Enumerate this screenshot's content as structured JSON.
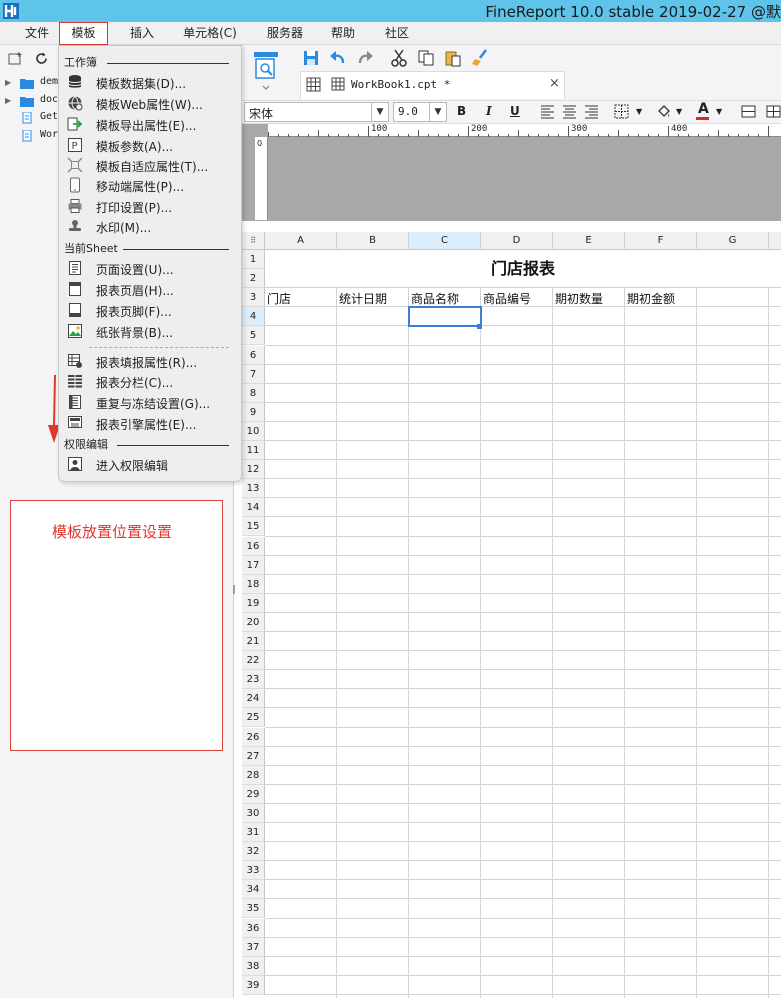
{
  "window": {
    "title": "FineReport 10.0 stable 2019-02-27 @默"
  },
  "menubar": {
    "items": [
      {
        "label": "文件"
      },
      {
        "label": "模板"
      },
      {
        "label": "插入"
      },
      {
        "label": "单元格(C)"
      },
      {
        "label": "服务器"
      },
      {
        "label": "帮助"
      },
      {
        "label": "社区"
      }
    ]
  },
  "tree": {
    "items": [
      {
        "label": "dem",
        "icon": "folder-icon"
      },
      {
        "label": "doc",
        "icon": "folder-icon"
      },
      {
        "label": "Get",
        "icon": "report-file-icon"
      },
      {
        "label": "Wor",
        "icon": "report-file-icon"
      }
    ]
  },
  "dropdown": {
    "sections": [
      {
        "title": "工作簿",
        "items": [
          {
            "label": "模板数据集(D)...",
            "icon": "database-icon"
          },
          {
            "label": "模板Web属性(W)...",
            "icon": "web-globe-icon"
          },
          {
            "label": "模板导出属性(E)...",
            "icon": "export-icon"
          },
          {
            "label": "模板参数(A)...",
            "icon": "parameter-icon"
          },
          {
            "label": "模板自适应属性(T)...",
            "icon": "adaptive-icon"
          },
          {
            "label": "移动端属性(P)...",
            "icon": "mobile-icon"
          },
          {
            "label": "打印设置(P)...",
            "icon": "printer-icon"
          },
          {
            "label": "水印(M)...",
            "icon": "watermark-stamp-icon"
          }
        ]
      },
      {
        "title": "当前Sheet",
        "items": [
          {
            "label": "页面设置(U)...",
            "icon": "page-setup-icon"
          },
          {
            "label": "报表页眉(H)...",
            "icon": "header-icon"
          },
          {
            "label": "报表页脚(F)...",
            "icon": "footer-icon"
          },
          {
            "label": "纸张背景(B)...",
            "icon": "paper-background-icon"
          },
          {
            "label": "报表填报属性(R)...",
            "icon": "fill-attribute-icon"
          },
          {
            "label": "报表分栏(C)...",
            "icon": "columns-icon"
          },
          {
            "label": "重复与冻结设置(G)...",
            "icon": "freeze-icon"
          },
          {
            "label": "报表引擎属性(E)...",
            "icon": "engine-icon"
          }
        ]
      },
      {
        "title": "权限编辑",
        "items": [
          {
            "label": "进入权限编辑",
            "icon": "permission-icon"
          }
        ]
      }
    ]
  },
  "annotation": {
    "text": "模板放置位置设置",
    "color": "#e0362e"
  },
  "tab": {
    "label": "WorkBook1.cpt *",
    "close": "×"
  },
  "format": {
    "font_name": "宋体",
    "font_size": "9.0",
    "bold": "B",
    "italic": "I",
    "underline": "U",
    "font_color_letter": "A"
  },
  "ruler": {
    "marks": [
      "100",
      "200",
      "300",
      "400"
    ],
    "vertical_mark": "0"
  },
  "sheet": {
    "corner": "⠿",
    "columns": [
      "A",
      "B",
      "C",
      "D",
      "E",
      "F",
      "G"
    ],
    "selected_column": "C",
    "selected_row": "4",
    "rows": [
      "1",
      "2",
      "3",
      "4",
      "5",
      "6",
      "7",
      "8",
      "9",
      "10",
      "11",
      "12",
      "13",
      "14",
      "15",
      "16",
      "17",
      "18",
      "19",
      "20",
      "21",
      "22",
      "23",
      "24",
      "25",
      "26",
      "27",
      "28",
      "29",
      "30",
      "31",
      "32",
      "33",
      "34",
      "35",
      "36",
      "37",
      "38",
      "39"
    ],
    "title": "门店报表",
    "headers": [
      "门店",
      "统计日期",
      "商品名称",
      "商品编号",
      "期初数量",
      "期初金额"
    ]
  },
  "colors": {
    "titlebar": "#5ec4ea",
    "accent": "#3c7fd6",
    "menu_highlight_border": "#e0362e"
  }
}
